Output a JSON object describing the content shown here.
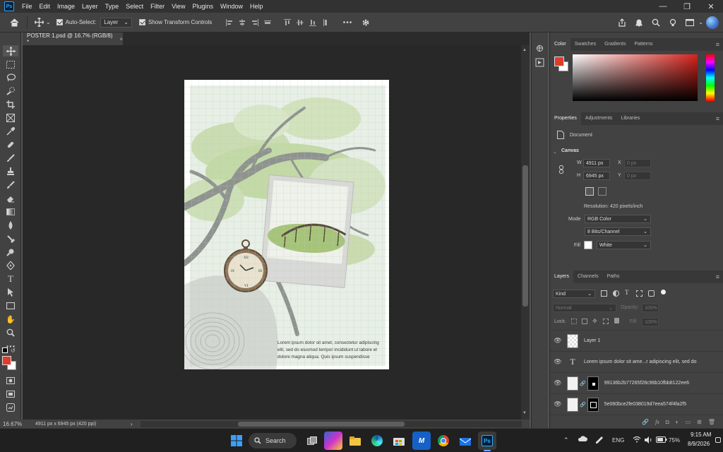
{
  "menubar": {
    "logo": "Ps",
    "items": [
      "File",
      "Edit",
      "Image",
      "Layer",
      "Type",
      "Select",
      "Filter",
      "View",
      "Plugins",
      "Window",
      "Help"
    ],
    "window_controls": [
      "—",
      "❐",
      "✕"
    ]
  },
  "options": {
    "auto_select_label": "Auto-Select:",
    "auto_select_target": "Layer",
    "transform_label": "Show Transform Controls"
  },
  "document": {
    "tab_title": "POSTER 1.psd @ 16.7% (RGB/8) *",
    "close": "×",
    "poster_text": "Lorem ipsum dolor sit amet, consectetur adipiscing elit, sed do eiusmod tempor incididunt ut labore et dolore magna aliqua. Quis ipsum suspendisse"
  },
  "status": {
    "zoom": "16.67%",
    "info": "4911 px x 6945 px (420 ppi)",
    "arrow": "›"
  },
  "color_panel": {
    "tabs": [
      "Color",
      "Swatches",
      "Gradients",
      "Patterns"
    ],
    "foreground": "#e03c2c",
    "background": "#ffffff"
  },
  "properties": {
    "tabs": [
      "Properties",
      "Adjustments",
      "Libraries"
    ],
    "doc_label": "Document",
    "section": "Canvas",
    "w_label": "W",
    "w_value": "4911 px",
    "h_label": "H",
    "h_value": "6945 px",
    "x_label": "X",
    "x_placeholder": "0 px",
    "y_label": "Y",
    "y_placeholder": "0 px",
    "resolution": "Resolution: 420 pixels/inch",
    "mode_label": "Mode",
    "mode_value": "RGB Color",
    "depth_value": "8 Bits/Channel",
    "fill_label": "Fill",
    "fill_value": "White"
  },
  "layers_panel": {
    "tabs": [
      "Layers",
      "Channels",
      "Paths"
    ],
    "kind": "Kind",
    "blend": "Normal",
    "opacity_label": "Opacity:",
    "opacity_value": "100%",
    "lock_label": "Lock:",
    "fill_label": "Fill:",
    "fill_value": "100%",
    "layers": [
      {
        "name": "Layer 1",
        "kind": "pixel"
      },
      {
        "name": "Lorem ipsum dolor sit ame...r adipiscing elit, sed do",
        "kind": "text"
      },
      {
        "name": "99136b2b77265f28c96b10fbb8122ee6",
        "kind": "masked"
      },
      {
        "name": "5e060bce2fe038019d7eea574f4fa2f5",
        "kind": "masked"
      }
    ]
  },
  "taskbar": {
    "search": "Search",
    "lang": "ENG",
    "battery": "75%",
    "time": "9:15 AM",
    "date": "8/9/2026"
  }
}
